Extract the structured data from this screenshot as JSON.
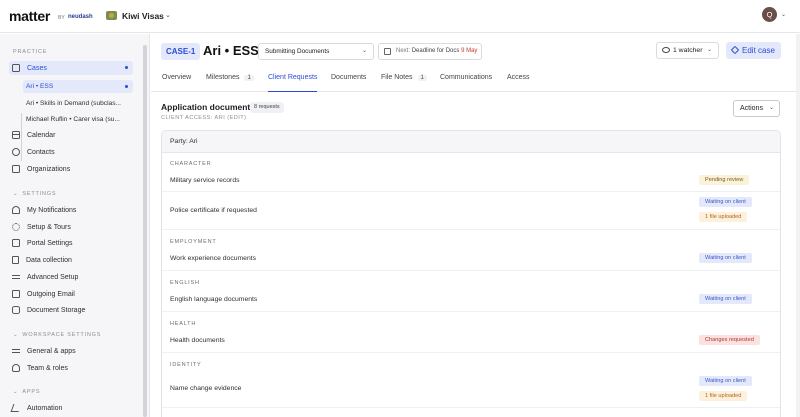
{
  "topbar": {
    "logo": "matter",
    "logo_by": "BY",
    "logo_brand": "neudash",
    "workspace": "Kiwi Visas",
    "avatar_initial": "Q"
  },
  "sidebar": {
    "practice_heading": "PRACTICE",
    "cases": "Cases",
    "sub_cases": [
      "Ari • ESS",
      "Ari • Skills in Demand (subclas...",
      "Michael Ruflin • Carer visa (su..."
    ],
    "calendar": "Calendar",
    "contacts": "Contacts",
    "organizations": "Organizations",
    "settings_heading": "SETTINGS",
    "settings_items": [
      "My Notifications",
      "Setup & Tours",
      "Portal Settings",
      "Data collection",
      "Advanced Setup",
      "Outgoing Email",
      "Document Storage"
    ],
    "workspace_heading": "WORKSPACE SETTINGS",
    "workspace_items": [
      "General & apps",
      "Team & roles"
    ],
    "apps_heading": "APPS",
    "apps_items": [
      "Automation"
    ]
  },
  "header": {
    "case_id": "CASE-1",
    "case_title": "Ari • ESS",
    "stage": "Submitting Documents",
    "deadline_prefix": "Next:",
    "deadline_label": "Deadline for Docs",
    "deadline_date": "9 May",
    "watcher": "1 watcher",
    "edit": "Edit case"
  },
  "tabs": [
    {
      "label": "Overview"
    },
    {
      "label": "Milestones",
      "count": "1"
    },
    {
      "label": "Client Requests"
    },
    {
      "label": "Documents"
    },
    {
      "label": "File Notes",
      "count": "1"
    },
    {
      "label": "Communications"
    },
    {
      "label": "Access"
    }
  ],
  "documents": {
    "title": "Application documents",
    "count": "8 requests",
    "client_access": "CLIENT ACCESS: ARI (EDIT)",
    "actions": "Actions",
    "party": "Party: Ari",
    "categories": [
      {
        "name": "CHARACTER",
        "items": [
          {
            "label": "Military service records",
            "badges": [
              "Pending review"
            ]
          },
          {
            "label": "Police certificate if requested",
            "badges": [
              "Waiting on client",
              "1 file uploaded"
            ]
          }
        ]
      },
      {
        "name": "EMPLOYMENT",
        "items": [
          {
            "label": "Work experience documents",
            "badges": [
              "Waiting on client"
            ]
          }
        ]
      },
      {
        "name": "ENGLISH",
        "items": [
          {
            "label": "English language documents",
            "badges": [
              "Waiting on client"
            ]
          }
        ]
      },
      {
        "name": "HEALTH",
        "items": [
          {
            "label": "Health documents",
            "badges": [
              "Changes requested"
            ]
          }
        ]
      },
      {
        "name": "IDENTITY",
        "items": [
          {
            "label": "Name change evidence",
            "badges": [
              "Waiting on client",
              "1 file uploaded"
            ]
          }
        ]
      }
    ]
  },
  "colors": {
    "accent": "#2a4bd7",
    "accent_bg": "#e3e9fb",
    "pending_bg": "#fbf2dc",
    "changes_bg": "#fbe2e0"
  }
}
